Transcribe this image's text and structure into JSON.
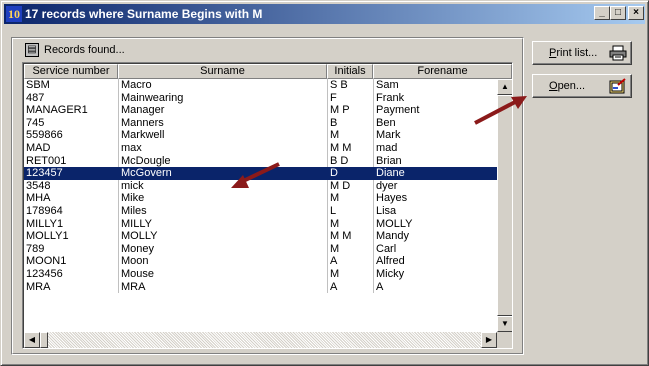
{
  "window": {
    "app_icon": "10",
    "title": "17 records where Surname Begins with M",
    "controls": {
      "minimize": "_",
      "maximize": "□",
      "close": "×"
    }
  },
  "panel": {
    "label": "Records found..."
  },
  "table": {
    "columns": [
      "Service number",
      "Surname",
      "Initials",
      "Forename"
    ],
    "selected_index": 7,
    "rows": [
      [
        "SBM",
        "Macro",
        "S B",
        "Sam"
      ],
      [
        "487",
        "Mainwearing",
        "F",
        "Frank"
      ],
      [
        "MANAGER1",
        "Manager",
        "M P",
        "Payment"
      ],
      [
        "745",
        "Manners",
        "B",
        "Ben"
      ],
      [
        "559866",
        "Markwell",
        "M",
        "Mark"
      ],
      [
        "MAD",
        "max",
        "M M",
        "mad"
      ],
      [
        "RET001",
        "McDougle",
        "B D",
        "Brian"
      ],
      [
        "123457",
        "McGovern",
        "D",
        "Diane"
      ],
      [
        "3548",
        "mick",
        "M D",
        "dyer"
      ],
      [
        "MHA",
        "Mike",
        "M",
        "Hayes"
      ],
      [
        "178964",
        "Miles",
        "L",
        "Lisa"
      ],
      [
        "MILLY1",
        "MILLY",
        "M",
        "MOLLY"
      ],
      [
        "MOLLY1",
        "MOLLY",
        "M M",
        "Mandy"
      ],
      [
        "789",
        "Money",
        "M",
        "Carl"
      ],
      [
        "MOON1",
        "Moon",
        "A",
        "Alfred"
      ],
      [
        "123456",
        "Mouse",
        "M",
        "Micky"
      ],
      [
        "MRA",
        "MRA",
        "A",
        "A"
      ]
    ]
  },
  "buttons": {
    "print": {
      "label": "Print list...",
      "accel": "P",
      "rest": "rint list...",
      "icon": "printer-icon"
    },
    "open": {
      "label": "Open...",
      "accel": "O",
      "rest": "pen...",
      "icon": "open-record-icon"
    }
  },
  "colors": {
    "title_start": "#0a246a",
    "title_end": "#a6caf0",
    "selection": "#0a246a",
    "annotation_arrow": "#8b1a1a"
  }
}
